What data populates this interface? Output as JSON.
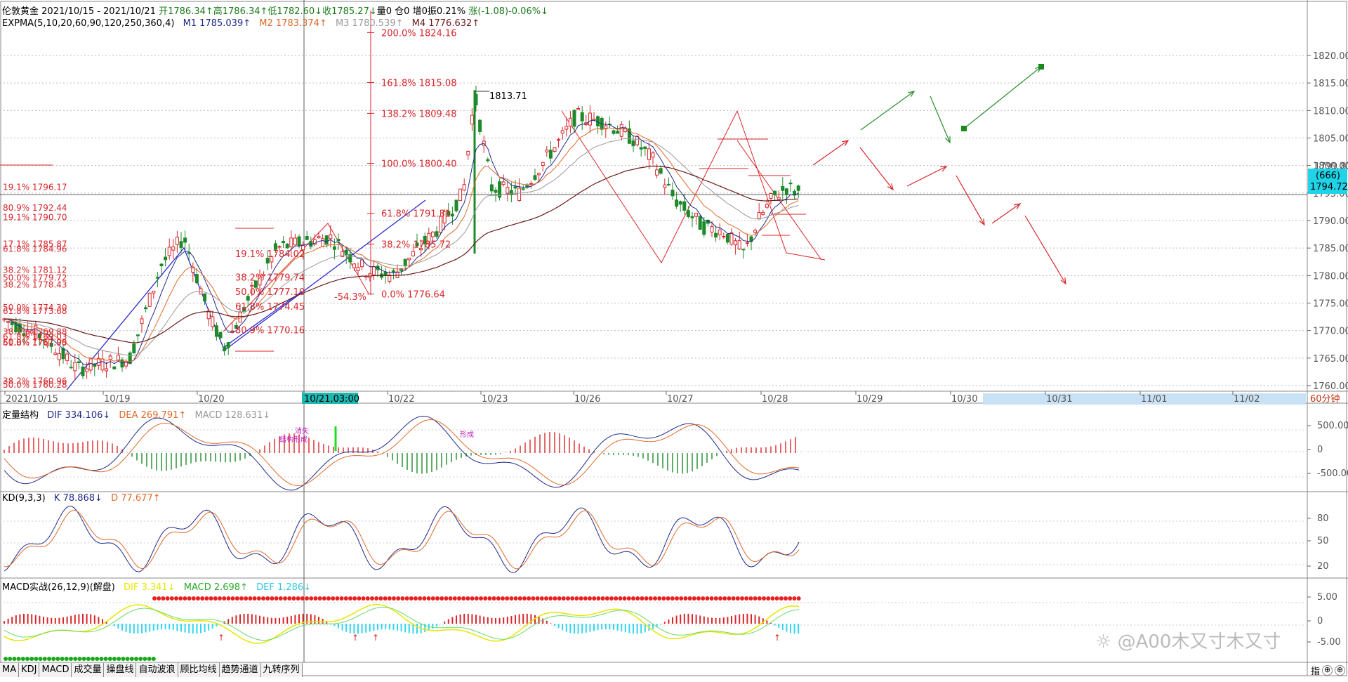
{
  "header": {
    "symbol": "伦敦黄金",
    "date_range": "2021/10/15 - 2021/10/21",
    "open": "开1786.34↑",
    "high": "高1786.34↑",
    "low": "低1782.60↓",
    "close": "收1785.27↓",
    "volume": "量0",
    "position": "仓0",
    "increase": "增0",
    "amplitude": "振0.21%",
    "change": "涨(-1.08)-0.06%↓"
  },
  "indicator_main": {
    "name": "EXPMA(5,10,20,60,90,120,250,360,4)",
    "m1": "M1 1785.039↑",
    "m2": "M2 1783.374↑",
    "m3": "M3 1780.539↑",
    "m4": "M4 1776.632↑"
  },
  "price_axis": [
    "1820.00",
    "1815.00",
    "1810.00",
    "1805.00",
    "1800.00",
    "1795.00",
    "1790.00",
    "1785.00",
    "1780.00",
    "1775.00",
    "1770.00",
    "1765.00",
    "1760.00"
  ],
  "price_marker": {
    "top": "1799.81",
    "count": "(666)",
    "current": "1794.72"
  },
  "date_axis": [
    "2021/10/15",
    "10/19",
    "10/20",
    "10/21,03:00",
    "10/22",
    "10/23",
    "10/26",
    "10/27",
    "10/28",
    "10/29",
    "10/30",
    "10/31",
    "11/01",
    "11/02"
  ],
  "period": "60分钟",
  "fib_right": [
    {
      "label": "200.0% 1824.16",
      "price": 1824.16
    },
    {
      "label": "161.8% 1815.08",
      "price": 1815.08
    },
    {
      "label": "138.2% 1809.48",
      "price": 1809.48
    },
    {
      "label": "100.0% 1800.40",
      "price": 1800.4
    },
    {
      "label": "61.8% 1791.31",
      "price": 1791.31
    },
    {
      "label": "38.2% 1785.72",
      "price": 1785.72
    },
    {
      "label": "0.0% 1776.64",
      "price": 1776.64
    }
  ],
  "fib_middle": [
    {
      "label": "19.1% 1784.02",
      "price": 1784.02
    },
    {
      "label": "38.2% 1779.74",
      "price": 1779.74
    },
    {
      "label": "50.0% 1777.10",
      "price": 1777.1
    },
    {
      "label": "61.8% 1774.45",
      "price": 1774.45
    },
    {
      "label": "80.9% 1770.16",
      "price": 1770.16
    }
  ],
  "fib_left": [
    {
      "label": "19.1% 1796.17",
      "price": 1796.17
    },
    {
      "label": "80.9% 1792.44",
      "price": 1792.44
    },
    {
      "label": "19.1% 1790.70",
      "price": 1790.7
    },
    {
      "label": "17.1% 1785.87",
      "price": 1785.87
    },
    {
      "label": "61.8% 1784.96",
      "price": 1784.96
    },
    {
      "label": "38.2% 1781.12",
      "price": 1781.12
    },
    {
      "label": "50.0% 1779.72",
      "price": 1779.72
    },
    {
      "label": "38.2% 1778.43",
      "price": 1778.43
    },
    {
      "label": "50.0% 1774.30",
      "price": 1774.3
    },
    {
      "label": "61.8% 1773.68",
      "price": 1773.68
    },
    {
      "label": "38.2% 1769.88",
      "price": 1769.88
    },
    {
      "label": "61.8% 1769.03",
      "price": 1769.03
    },
    {
      "label": "50.0% 1767.95",
      "price": 1767.95
    },
    {
      "label": "61.8% 1767.90",
      "price": 1767.9
    },
    {
      "label": "38.2% 1760.96",
      "price": 1760.96
    },
    {
      "label": "50.0% 1760.28",
      "price": 1760.28
    }
  ],
  "high_label": "1813.71",
  "neg_label": "-54.3%",
  "macd_panel": {
    "name": "定量结构",
    "dif": "DIF 334.106↓",
    "dea": "DEA 269.791↑",
    "macd": "MACD 128.631↓",
    "axis": [
      "500.00",
      "0",
      "-500.00"
    ]
  },
  "kd_panel": {
    "name": "KD(9,3,3)",
    "k": "K 78.868↓",
    "d": "D 77.677↑",
    "axis": [
      "80",
      "50",
      "20"
    ]
  },
  "macd2_panel": {
    "name": "MACD实战(26,12,9)(解盘)",
    "dif": "DIF 3.341↓",
    "macd": "MACD 2.698↑",
    "def": "DEF 1.286↓",
    "axis": [
      "5.00",
      "0",
      "-5.00"
    ]
  },
  "annotations": {
    "a1": "消失",
    "a2": "结构形成",
    "a3": "形成"
  },
  "watermark": "@A00木又寸木又寸",
  "tabs": [
    "MA",
    "KDJ",
    "MACD",
    "成交量",
    "操盘线",
    "自动波浪",
    "顾比均线",
    "趋势通道",
    "九转序列"
  ],
  "right_buttons": {
    "zhi": "指"
  },
  "colors": {
    "up": "#d9262a",
    "down": "#1d8a2a",
    "m1": "#1f2a8a",
    "m2": "#e06a2a",
    "m3": "#999999",
    "m4": "#6b1a1a",
    "yellow": "#e6e600",
    "cyan": "#33d6f2"
  }
}
